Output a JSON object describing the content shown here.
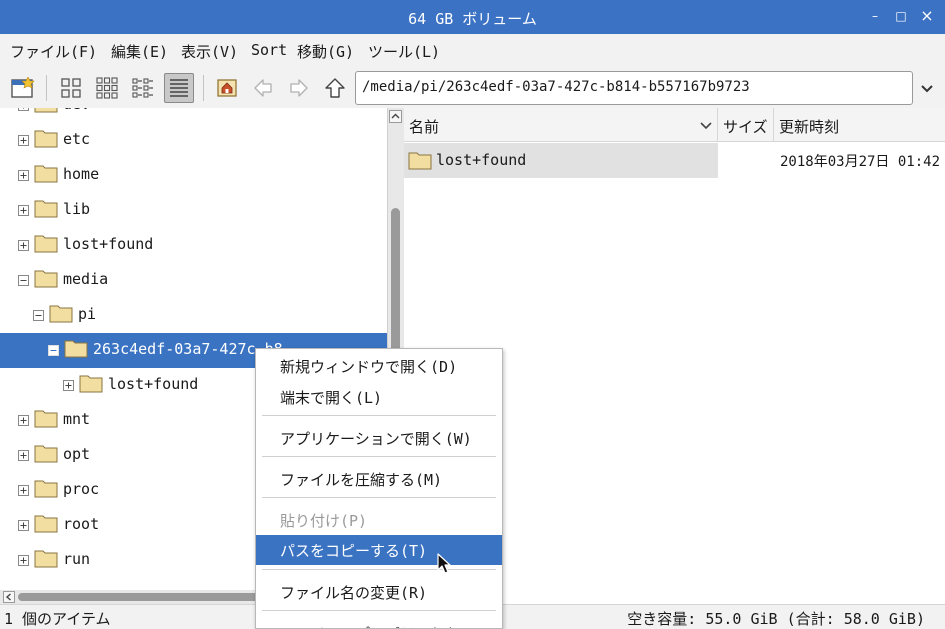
{
  "window": {
    "title": "64 GB ボリューム",
    "minimize": "–",
    "maximize": "□",
    "close": "×"
  },
  "menubar": {
    "items": [
      "ファイル(F)",
      "編集(E)",
      "表示(V)",
      "Sort",
      "移動(G)",
      "ツール(L)"
    ]
  },
  "toolbar": {
    "path": "/media/pi/263c4edf-03a7-427c-b814-b557167b9723",
    "buttons": [
      "new-window-icon",
      "view-icons-icon",
      "view-thumbnails-icon",
      "view-compact-icon",
      "view-list-icon",
      "home-icon",
      "back-icon",
      "forward-icon",
      "up-icon"
    ]
  },
  "tree": {
    "items": [
      {
        "label": "dev",
        "expander": "plus",
        "level": 0
      },
      {
        "label": "etc",
        "expander": "plus",
        "level": 0
      },
      {
        "label": "home",
        "expander": "plus",
        "level": 0
      },
      {
        "label": "lib",
        "expander": "plus",
        "level": 0
      },
      {
        "label": "lost+found",
        "expander": "plus",
        "level": 0
      },
      {
        "label": "media",
        "expander": "minus",
        "level": 0
      },
      {
        "label": "pi",
        "expander": "minus",
        "level": 1
      },
      {
        "label": "263c4edf-03a7-427c-b8",
        "expander": "minus",
        "level": 2,
        "selected": true
      },
      {
        "label": "lost+found",
        "expander": "plus",
        "level": 3
      },
      {
        "label": "mnt",
        "expander": "plus",
        "level": 0
      },
      {
        "label": "opt",
        "expander": "plus",
        "level": 0
      },
      {
        "label": "proc",
        "expander": "plus",
        "level": 0
      },
      {
        "label": "root",
        "expander": "plus",
        "level": 0
      },
      {
        "label": "run",
        "expander": "plus",
        "level": 0
      }
    ]
  },
  "filelist": {
    "columns": {
      "name": "名前",
      "size": "サイズ",
      "modified": "更新時刻"
    },
    "rows": [
      {
        "name": "lost+found",
        "size": "",
        "modified": "2018年03月27日 01:42"
      }
    ]
  },
  "context_menu": {
    "items": [
      {
        "label": "新規ウィンドウで開く(D)"
      },
      {
        "label": "端末で開く(L)"
      },
      {
        "sep": true
      },
      {
        "label": "アプリケーションで開く(W)"
      },
      {
        "sep": true
      },
      {
        "label": "ファイルを圧縮する(M)"
      },
      {
        "sep": true
      },
      {
        "label": "貼り付け(P)",
        "disabled": true
      },
      {
        "label": "パスをコピーする(T)",
        "highlighted": true
      },
      {
        "sep": true
      },
      {
        "label": "ファイル名の変更(R)"
      },
      {
        "sep": true
      },
      {
        "label": "ファイルのプロパティ(F)"
      }
    ]
  },
  "statusbar": {
    "left": "1 個のアイテム",
    "right": "空き容量: 55.0 GiB (合計: 58.0 GiB)"
  },
  "colors": {
    "titlebar": "#3c72c4",
    "selection": "#3b73c3",
    "folder": "#f2dea0"
  }
}
